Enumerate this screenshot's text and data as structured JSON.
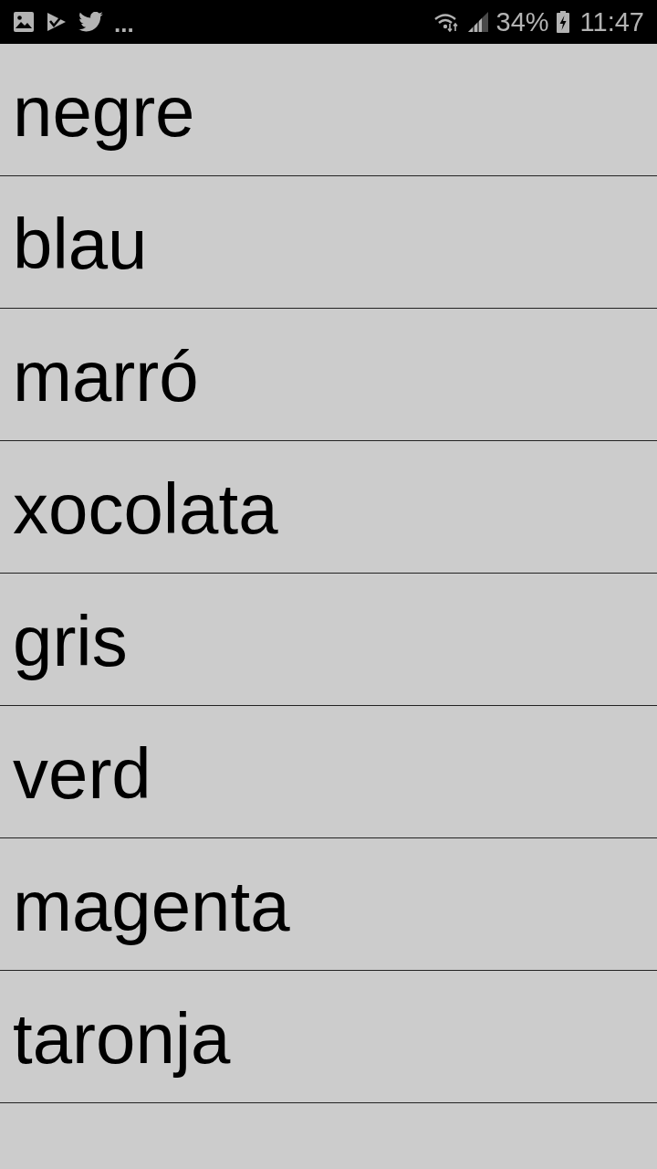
{
  "status_bar": {
    "overflow_indicator": "...",
    "battery": "34%",
    "time": "11:47"
  },
  "list": {
    "items": [
      "negre",
      "blau",
      "marró",
      "xocolata",
      "gris",
      "verd",
      "magenta",
      "taronja"
    ]
  }
}
